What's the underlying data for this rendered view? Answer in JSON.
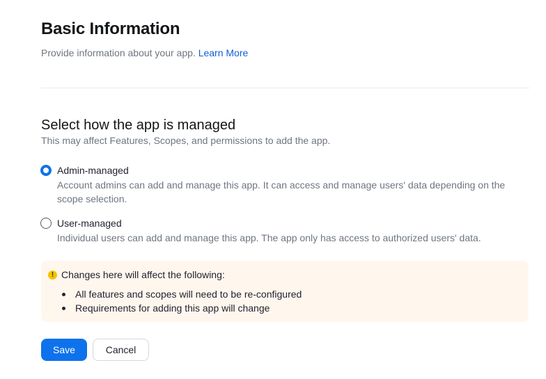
{
  "header": {
    "title": "Basic Information",
    "subtitle": "Provide information about your app.",
    "learn_more_label": "Learn More"
  },
  "management": {
    "title": "Select how the app is managed",
    "description": "This may affect Features, Scopes, and permissions to add the app.",
    "selected": "admin",
    "options": [
      {
        "id": "admin",
        "label": "Admin-managed",
        "description": "Account admins can add and manage this app. It can access and manage users' data depending on the scope selection.",
        "checked": true
      },
      {
        "id": "user",
        "label": "User-managed",
        "description": "Individual users can add and manage this app. The app only has access to authorized users' data.",
        "checked": false
      }
    ]
  },
  "notice": {
    "icon": "warning-icon",
    "icon_glyph": "!",
    "title": "Changes here will affect the following:",
    "items": [
      "All features and scopes will need to be re-configured",
      "Requirements for adding this app will change"
    ]
  },
  "actions": {
    "save_label": "Save",
    "cancel_label": "Cancel"
  },
  "colors": {
    "accent": "#0e72ed",
    "link": "#0e5fd8",
    "notice_background": "#fff7ee",
    "warning": "#f5c400"
  }
}
